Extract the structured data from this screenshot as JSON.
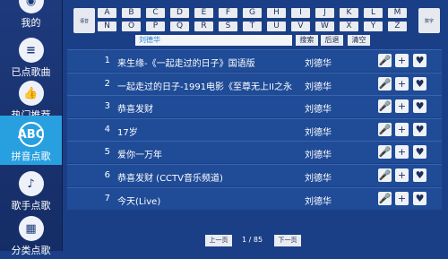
{
  "sidebar": {
    "items": [
      {
        "label": "我的",
        "icon": "user-icon",
        "glyph": "◉"
      },
      {
        "label": "已点歌曲",
        "icon": "list-icon",
        "glyph": "≡"
      },
      {
        "label": "热门推荐",
        "icon": "thumbs-up-icon",
        "glyph": "👍"
      },
      {
        "label": "拼音点歌",
        "icon": "pinyin-icon",
        "glyph": "ABC"
      },
      {
        "label": "歌手点歌",
        "icon": "singer-icon",
        "glyph": "♪"
      },
      {
        "label": "分类点歌",
        "icon": "category-icon",
        "glyph": "▦"
      }
    ],
    "active_index": 3
  },
  "keyboard": {
    "left_label": "语音",
    "right_label": "数字",
    "row1": [
      "A",
      "B",
      "C",
      "D",
      "E",
      "F",
      "G",
      "H",
      "I",
      "J",
      "K",
      "L",
      "M"
    ],
    "row2": [
      "N",
      "O",
      "P",
      "Q",
      "R",
      "S",
      "T",
      "U",
      "V",
      "W",
      "X",
      "Y",
      "Z"
    ]
  },
  "search": {
    "value": "刘德华",
    "search_label": "搜索",
    "back_label": "后退",
    "clear_label": "清空"
  },
  "songs": [
    {
      "no": "1",
      "title": "来生缘-《一起走过的日子》国语版",
      "artist": "刘德华"
    },
    {
      "no": "2",
      "title": "一起走过的日子-1991电影《至尊无上II之永...",
      "artist": "刘德华"
    },
    {
      "no": "3",
      "title": "恭喜发财",
      "artist": "刘德华"
    },
    {
      "no": "4",
      "title": "17岁",
      "artist": "刘德华"
    },
    {
      "no": "5",
      "title": "爱你一万年",
      "artist": "刘德华"
    },
    {
      "no": "6",
      "title": "恭喜发财 (CCTV音乐频道)",
      "artist": "刘德华"
    },
    {
      "no": "7",
      "title": "今天(Live)",
      "artist": "刘德华"
    }
  ],
  "pagination": {
    "prev_label": "上一页",
    "next_label": "下一页",
    "page_info": "1 / 85"
  },
  "colors": {
    "background": "#1b3f86",
    "active_nav": "#28a0e0",
    "search_text": "#2b7fd6"
  }
}
